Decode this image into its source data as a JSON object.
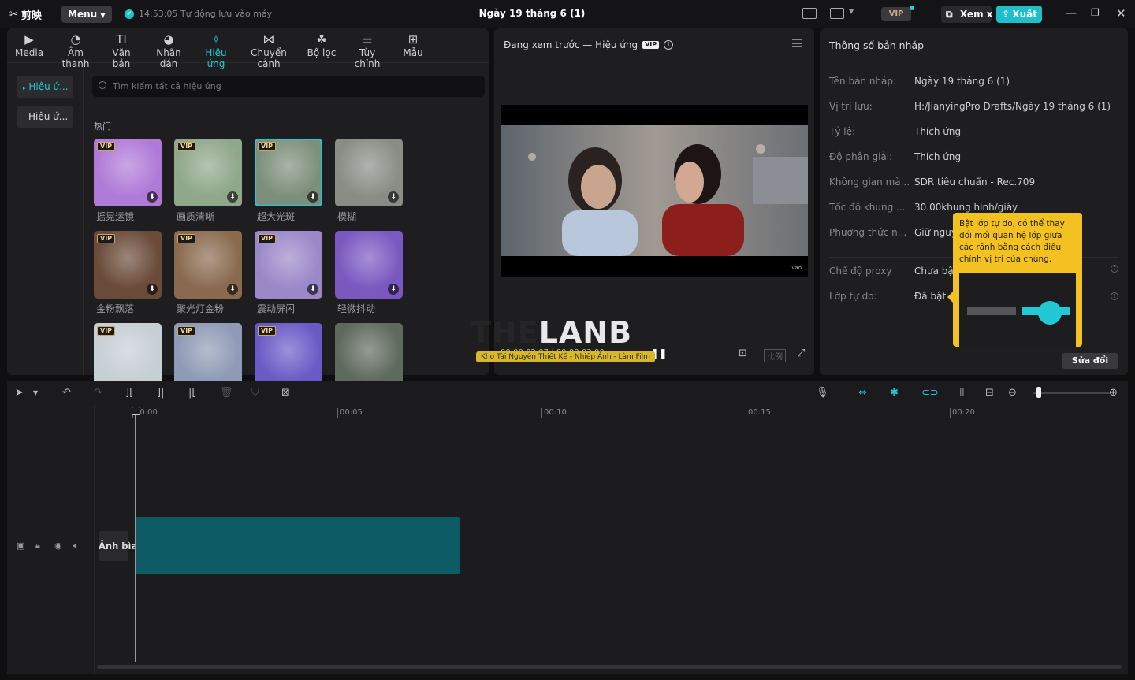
{
  "titlebar": {
    "app_name": "剪映",
    "menu_label": "Menu",
    "autosave_text": "14:53:05 Tự động lưu vào máy",
    "project_title": "Ngày 19 tháng 6 (1)",
    "vip_label": "VIP",
    "review_label": "Xem xét",
    "export_label": "Xuất"
  },
  "media_tabs": [
    {
      "label": "Media",
      "icon": "media-icon"
    },
    {
      "label": "Âm thanh",
      "icon": "audio-icon"
    },
    {
      "label": "Văn bản",
      "icon": "text-icon"
    },
    {
      "label": "Nhãn dán",
      "icon": "sticker-icon"
    },
    {
      "label": "Hiệu ứng",
      "icon": "effects-icon",
      "active": true
    },
    {
      "label": "Chuyển cảnh",
      "icon": "transition-icon"
    },
    {
      "label": "Bộ lọc",
      "icon": "filter-icon"
    },
    {
      "label": "Tùy chỉnh",
      "icon": "adjust-icon"
    },
    {
      "label": "Mẫu",
      "icon": "template-icon"
    }
  ],
  "effects_nav": [
    {
      "label": "Hiệu ứ...",
      "active": true
    },
    {
      "label": "Hiệu ứ..."
    }
  ],
  "search": {
    "placeholder": "Tìm kiếm tất cả hiệu ứng"
  },
  "section_title": "热门",
  "effects": [
    {
      "name": "摇晃运镜",
      "vip": "VIP",
      "color": "#b07ad8"
    },
    {
      "name": "画质清晰",
      "vip": "VIP",
      "color": "#8fa78a"
    },
    {
      "name": "超大光斑",
      "vip": "VIP",
      "color": "#7d8f7a",
      "selected": true
    },
    {
      "name": "模糊",
      "vip": "",
      "color": "#8a8c86"
    },
    {
      "name": "金粉飘落",
      "vip": "VIP",
      "color": "#6a4a38"
    },
    {
      "name": "聚光灯金粉",
      "vip": "VIP",
      "color": "#8a6a4e"
    },
    {
      "name": "震动屏闪",
      "vip": "VIP",
      "color": "#9a88c8"
    },
    {
      "name": "轻微抖动",
      "vip": "",
      "color": "#7a58c0"
    },
    {
      "name": "",
      "vip": "VIP",
      "color": "#c6cfd4"
    },
    {
      "name": "",
      "vip": "VIP",
      "color": "#8e9ab6"
    },
    {
      "name": "",
      "vip": "VIP",
      "color": "#6a5ac6"
    },
    {
      "name": "",
      "vip": "",
      "color": "#5e6a5c"
    }
  ],
  "preview": {
    "title": "Đang xem trước — Hiệu ứng",
    "vip_badge": "VIP",
    "current_time": "00:00:02:07",
    "total_time": "00:00:03:00",
    "ratio_label": "比例",
    "watermark": "Vao",
    "banner_text": "Kho Tài Nguyên Thiết Kế - Nhiếp Ảnh - Làm Film",
    "logo_text_dark": "THE",
    "logo_text_light": "LANB"
  },
  "properties": {
    "header": "Thông số bản nháp",
    "rows": [
      {
        "label": "Tên bản nháp:",
        "value": "Ngày 19 tháng 6 (1)"
      },
      {
        "label": "Vị trí lưu:",
        "value": "H:/JianyingPro Drafts/Ngày 19 tháng 6 (1)"
      },
      {
        "label": "Tỷ lệ:",
        "value": "Thích ứng"
      },
      {
        "label": "Độ phân giải:",
        "value": "Thích ứng"
      },
      {
        "label": "Không gian mà...",
        "value": "SDR tiêu chuẩn - Rec.709"
      },
      {
        "label": "Tốc độ khung ...",
        "value": "30.00khung hình/giây"
      },
      {
        "label": "Phương thức n...",
        "value": "Giữ nguy"
      }
    ],
    "rows2": [
      {
        "label": "Chế độ proxy",
        "value": "Chưa bậ"
      },
      {
        "label": "Lớp tự do:",
        "value": "Đã bật"
      }
    ],
    "modify_label": "Sửa đổi",
    "tooltip": "Bật lớp tự do, có thể thay đổi mối quan hệ lớp giữa các rãnh bằng cách điều chỉnh vị trí của chúng."
  },
  "timeline": {
    "ticks": [
      "00:00",
      "00:05",
      "00:10",
      "00:15",
      "00:20"
    ],
    "cover_label": "Ảnh bìa",
    "clip_color": "#0d5b64"
  },
  "colors": {
    "accent": "#22c8d6",
    "export": "#1ebeca",
    "tooltip": "#f3c221"
  }
}
